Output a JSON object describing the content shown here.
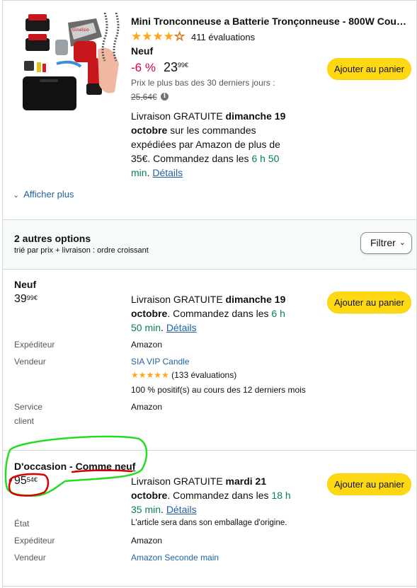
{
  "main_offer": {
    "title": "Mini Tronconneuse a Batterie Tronçonneuse - 800W Coup...",
    "stars": "★★★★☆",
    "rating_value": 4.0,
    "rating_count": "411 évaluations",
    "condition": "Neuf",
    "discount": "-6 %",
    "price_whole": "23",
    "price_fraction": "99",
    "currency": "€",
    "lowest_label": "Prix le plus bas des 30 derniers jours :",
    "strike_price": "25,64€",
    "info_glyph": "i",
    "delivery_prefix": "Livraison GRATUITE ",
    "delivery_date": "dimanche 19 octobre",
    "delivery_rest": " sur les commandes expédiées par Amazon de plus de 35€. Commandez dans les ",
    "delivery_time": "6 h 50 min",
    "delivery_dot": ". ",
    "details_link": "Détails",
    "add_button": "Ajouter au panier"
  },
  "show_more": {
    "chevron": "⌄",
    "label": "Afficher plus"
  },
  "options_header": {
    "title": "2 autres options",
    "subtitle": "trié par prix + livraison : ordre croissant",
    "filter_label": "Filtrer",
    "filter_chevron": "⌄"
  },
  "offer_new": {
    "condition": "Neuf",
    "price_whole": "39",
    "price_fraction": "99",
    "currency": "€",
    "delivery_prefix": "Livraison GRATUITE ",
    "delivery_date": "dimanche 19 octobre",
    "delivery_rest": ". Commandez dans les ",
    "delivery_time": "6 h 50 min",
    "delivery_dot": ". ",
    "details_link": "Détails",
    "add_button": "Ajouter au panier",
    "shipper_label": "Expéditeur",
    "shipper_value": "Amazon",
    "seller_label": "Vendeur",
    "seller_value": "SIA VIP Candle",
    "seller_stars": "★★★★★",
    "seller_rating_count": "(133 évaluations)",
    "seller_positive": "100 % positif(s) au cours des 12 derniers mois",
    "service_label_1": "Service",
    "service_label_2": "client",
    "service_value": "Amazon"
  },
  "offer_used": {
    "condition_prefix": "D'occasion - ",
    "condition_grade": "Comme neuf",
    "price_whole": "95",
    "price_fraction": "54",
    "currency": "€",
    "delivery_prefix": "Livraison GRATUITE ",
    "delivery_date": "mardi 21 octobre",
    "delivery_rest": ". Commandez dans les ",
    "delivery_time": "18 h 35 min",
    "delivery_dot": ". ",
    "details_link": "Détails",
    "add_button": "Ajouter au panier",
    "state_label": "État",
    "state_value": "L'article sera dans son emballage d'origine.",
    "shipper_label": "Expéditeur",
    "shipper_value": "Amazon",
    "seller_label": "Vendeur",
    "seller_value": "Amazon Seconde main"
  },
  "annotations": {
    "green_color": "#22dd22",
    "red_color": "#d80000"
  },
  "colors": {
    "button_yellow": "#ffd814",
    "deal_red": "#cc0c39",
    "link_blue": "#2162a1",
    "time_green": "#067d62",
    "star_orange": "#ffa41c"
  }
}
